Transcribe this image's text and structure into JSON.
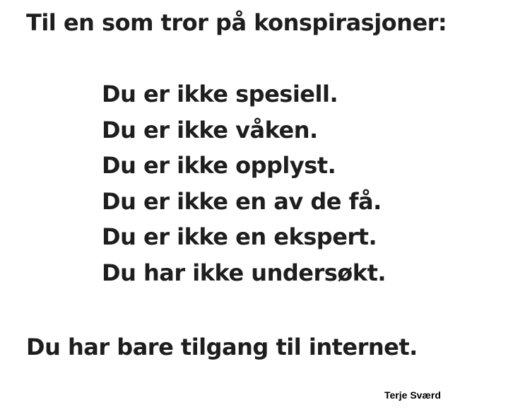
{
  "heading": "Til en som tror på konspirasjoner:",
  "lines": [
    "Du er ikke spesiell.",
    "Du er ikke våken.",
    "Du er ikke opplyst.",
    "Du er ikke en av de få.",
    "Du er ikke en ekspert.",
    "Du har ikke undersøkt."
  ],
  "conclusion": "Du har bare tilgang til internet.",
  "signature": "Terje Sværd",
  "colors": {
    "text": "#1e1e1e",
    "background": "#ffffff"
  }
}
